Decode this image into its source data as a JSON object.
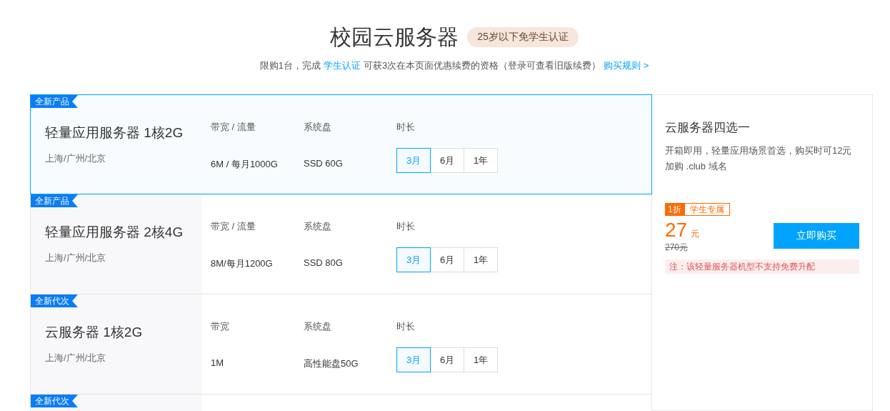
{
  "header": {
    "title": "校园云服务器",
    "badge": "25岁以下免学生认证",
    "notice": [
      {
        "kind": "text",
        "text": "限购1台，完成"
      },
      {
        "kind": "link",
        "text": "学生认证"
      },
      {
        "kind": "text",
        "text": "可获3次在本页面优惠续费的资格（登录可查看旧版续费）"
      },
      {
        "kind": "link",
        "text": "购买规则 >"
      }
    ]
  },
  "products": [
    {
      "badge": "全新产品",
      "name": "轻量应用服务器 1核2G",
      "regions": "上海/广州/北京",
      "selected": true,
      "specs": [
        {
          "label": "带宽 / 流量",
          "value": "6M / 每月1000G"
        },
        {
          "label": "系统盘",
          "value": "SSD 60G"
        }
      ],
      "duration_label": "时长",
      "durations": [
        {
          "label": "3月",
          "selected": true
        },
        {
          "label": "6月",
          "selected": false
        },
        {
          "label": "1年",
          "selected": false
        }
      ]
    },
    {
      "badge": "全新产品",
      "name": "轻量应用服务器 2核4G",
      "regions": "上海/广州/北京",
      "selected": false,
      "specs": [
        {
          "label": "带宽 / 流量",
          "value": "8M/每月1200G"
        },
        {
          "label": "系统盘",
          "value": "SSD 80G"
        }
      ],
      "duration_label": "时长",
      "durations": [
        {
          "label": "3月",
          "selected": true
        },
        {
          "label": "6月",
          "selected": false
        },
        {
          "label": "1年",
          "selected": false
        }
      ]
    },
    {
      "badge": "全新代次",
      "name": "云服务器 1核2G",
      "regions": "上海/广州/北京",
      "selected": false,
      "specs": [
        {
          "label": "带宽",
          "value": "1M"
        },
        {
          "label": "系统盘",
          "value": "高性能盘50G"
        }
      ],
      "duration_label": "时长",
      "durations": [
        {
          "label": "3月",
          "selected": true
        },
        {
          "label": "6月",
          "selected": false
        },
        {
          "label": "1年",
          "selected": false
        }
      ]
    },
    {
      "badge": "全新代次",
      "selected": false
    }
  ],
  "summary": {
    "title": "云服务器四选一",
    "description": "开箱即用，轻量应用场景首选，购买时可12元加购 .club 域名",
    "discount": "1折",
    "tag": "学生专属",
    "price": "27",
    "unit": "元",
    "original_price": "270元",
    "button": "立即购买",
    "note": "注：该轻量服务器机型不支持免费升配"
  }
}
